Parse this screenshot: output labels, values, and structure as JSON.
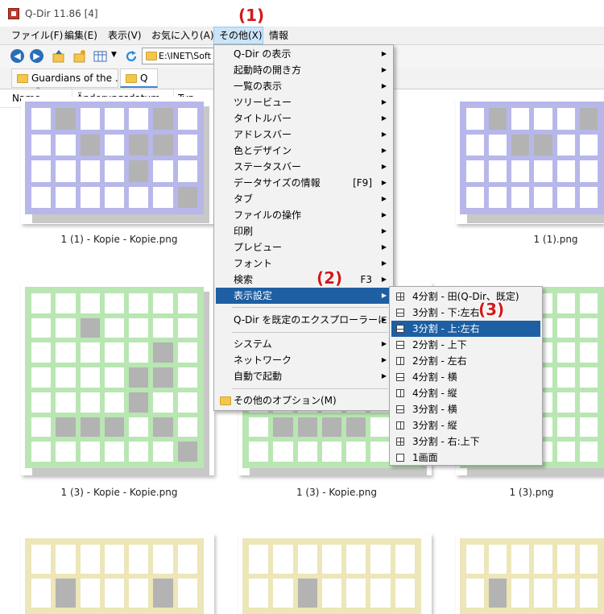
{
  "window": {
    "title": "Q-Dir 11.86 [4]"
  },
  "menubar": [
    "ファイル(F)",
    "編集(E)",
    "表示(V)",
    "お気に入り(A)",
    "その他(X)",
    "情報"
  ],
  "toolbar": {
    "address": "E:\\INET\\Soft"
  },
  "tabs": [
    "Guardians of the ...",
    "Q"
  ],
  "columns": [
    "Name",
    "Änderungsdatum",
    "Typ"
  ],
  "files": [
    "1 (1) - Kopie - Kopie.png",
    "1 (1).png",
    "1 (3) - Kopie - Kopie.png",
    "1 (3) - Kopie.png",
    "1 (3).png"
  ],
  "menu_other": {
    "items": [
      {
        "label": "Q-Dir の表示",
        "arrow": true
      },
      {
        "label": "起動時の開き方",
        "arrow": true
      },
      {
        "label": "一覧の表示",
        "arrow": true
      },
      {
        "label": "ツリービュー",
        "arrow": true
      },
      {
        "label": "タイトルバー",
        "arrow": true
      },
      {
        "label": "アドレスバー",
        "arrow": true
      },
      {
        "label": "色とデザイン",
        "arrow": true
      },
      {
        "label": "ステータスバー",
        "arrow": true
      },
      {
        "label": "データサイズの情報",
        "shortcut": "[F9]",
        "arrow": true
      },
      {
        "label": "タブ",
        "arrow": true
      },
      {
        "label": "ファイルの操作",
        "arrow": true
      },
      {
        "label": "印刷",
        "arrow": true
      },
      {
        "label": "プレビュー",
        "arrow": true
      },
      {
        "label": "フォント",
        "arrow": true
      },
      {
        "label": "検索",
        "shortcut": "F3",
        "arrow": true
      },
      {
        "label": "表示設定",
        "arrow": true,
        "highlighted": true
      },
      {
        "label": "Q-Dir を既定のエクスプローラーに",
        "arrow": true
      },
      {
        "label": "システム",
        "arrow": true
      },
      {
        "label": "ネットワーク",
        "arrow": true
      },
      {
        "label": "自動で起動",
        "arrow": true
      },
      {
        "label": "その他のオプション(M)",
        "arrow": false
      }
    ]
  },
  "submenu_layout": {
    "items": [
      {
        "label": "4分割 - 田(Q-Dir、既定)",
        "icon": "grid-4-icon"
      },
      {
        "label": "3分割 - 下:左右",
        "icon": "layout-3-bottom-icon"
      },
      {
        "label": "3分割 - 上:左右",
        "icon": "layout-3-top-icon",
        "highlighted": true
      },
      {
        "label": "2分割 - 上下",
        "icon": "layout-2-horizontal-icon"
      },
      {
        "label": "2分割 - 左右",
        "icon": "layout-2-vertical-icon"
      },
      {
        "label": "4分割 - 横",
        "icon": "layout-4-rows-icon"
      },
      {
        "label": "4分割 - 縦",
        "icon": "layout-4-columns-icon"
      },
      {
        "label": "3分割 - 横",
        "icon": "layout-3-rows-icon"
      },
      {
        "label": "3分割 - 縦",
        "icon": "layout-3-columns-icon"
      },
      {
        "label": "3分割 - 右:上下",
        "icon": "layout-3-right-icon"
      },
      {
        "label": "1画面",
        "icon": "single-pane-icon"
      }
    ]
  },
  "annotations": [
    "(1)",
    "(2)",
    "(3)"
  ],
  "colors": {
    "highlight": "#1e5fa3",
    "annotation": "#d21a1a",
    "thumb_blue": "#b7b7ea",
    "thumb_green": "#b9e6b3",
    "thumb_yellow": "#ece6b8"
  }
}
